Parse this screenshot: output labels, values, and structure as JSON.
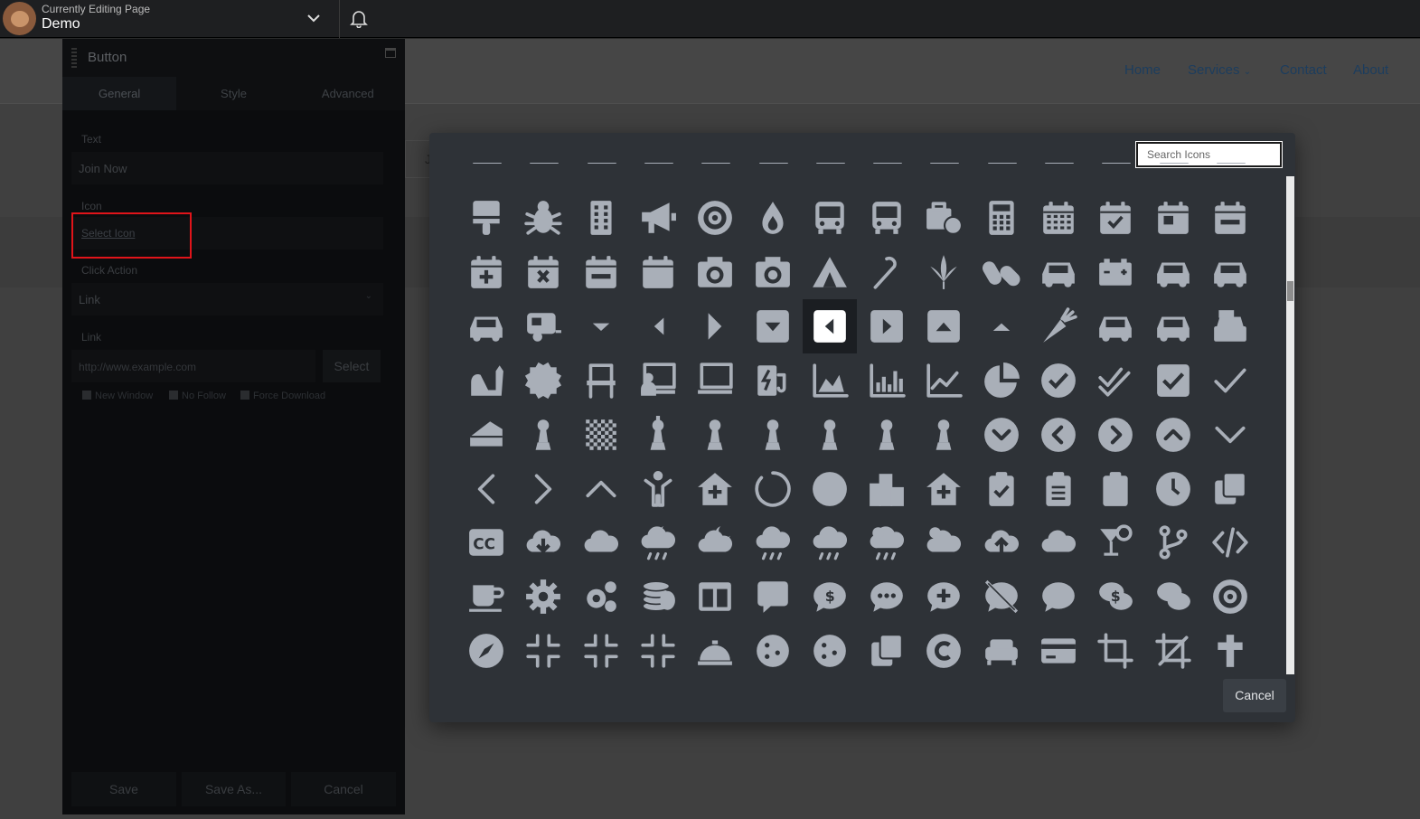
{
  "topbar": {
    "subtitle": "Currently Editing Page",
    "page_name": "Demo"
  },
  "site_nav": {
    "items": [
      "Home",
      "Services",
      "Contact",
      "About"
    ],
    "box_letter": "J"
  },
  "panel": {
    "title": "Button",
    "tabs": [
      "General",
      "Style",
      "Advanced"
    ],
    "active_tab": "General",
    "fields": {
      "text_label": "Text",
      "text_value": "Join Now",
      "icon_label": "Icon",
      "select_icon": "Select Icon",
      "click_action_label": "Click Action",
      "click_action_value": "Link",
      "link_label": "Link",
      "link_placeholder": "http://www.example.com",
      "link_select": "Select"
    },
    "checkboxes": [
      "New Window",
      "No Follow",
      "Force Download"
    ],
    "footer": {
      "save": "Save",
      "save_as": "Save As...",
      "cancel": "Cancel"
    }
  },
  "icon_picker": {
    "search_placeholder": "Search Icons",
    "cancel": "Cancel",
    "colors": {
      "icon": "#a9afb8",
      "selected_icon": "#ffffff",
      "background": "#2e3237"
    },
    "selected_index": 34,
    "icons": [
      "brush-icon",
      "bug-icon",
      "building-icon",
      "bullhorn-icon",
      "bullseye-icon",
      "burn-icon",
      "bus-icon",
      "bus-alt-icon",
      "business-time-icon",
      "calculator-icon",
      "calendar-icon",
      "calendar-check-icon",
      "calendar-day-icon",
      "calendar-minus-icon",
      "calendar-plus-icon",
      "calendar-times-icon",
      "calendar-week-icon",
      "calendar-blank-icon",
      "camera-retro-icon",
      "camera-icon",
      "campground-icon",
      "candy-cane-icon",
      "cannabis-icon",
      "capsules-icon",
      "car-icon",
      "car-battery-icon",
      "car-crash-icon",
      "car-side-icon",
      "car-alt-icon",
      "caravan-icon",
      "caret-down-icon",
      "caret-left-icon",
      "caret-right-icon",
      "caret-square-down-icon",
      "caret-square-left-icon",
      "caret-square-right-icon",
      "caret-square-up-icon",
      "caret-up-icon",
      "carrot-icon",
      "cart-arrow-down-icon",
      "cart-plus-icon",
      "cash-register-icon",
      "cat-icon",
      "certificate-icon",
      "chair-icon",
      "chalkboard-teacher-icon",
      "chalkboard-icon",
      "charging-station-icon",
      "chart-area-icon",
      "chart-bar-icon",
      "chart-line-icon",
      "chart-pie-icon",
      "check-circle-icon",
      "check-double-icon",
      "check-square-icon",
      "check-icon",
      "cheese-icon",
      "chess-bishop-icon",
      "chess-board-icon",
      "chess-king-icon",
      "chess-knight-icon",
      "chess-pawn-icon",
      "chess-queen-icon",
      "chess-rook-icon",
      "chess-icon",
      "chevron-circle-down-icon",
      "chevron-circle-left-icon",
      "chevron-circle-right-icon",
      "chevron-circle-up-icon",
      "chevron-down-icon",
      "chevron-left-icon",
      "chevron-right-icon",
      "chevron-up-icon",
      "child-icon",
      "church-icon",
      "circle-notch-icon",
      "circle-icon",
      "city-icon",
      "clinic-medical-icon",
      "clipboard-check-icon",
      "clipboard-list-icon",
      "clipboard-icon",
      "clock-icon",
      "clone-icon",
      "closed-captioning-icon",
      "cloud-download-icon",
      "cloud-meatball-icon",
      "cloud-moon-rain-icon",
      "cloud-moon-icon",
      "cloud-rain-icon",
      "cloud-showers-heavy-icon",
      "cloud-sun-rain-icon",
      "cloud-sun-icon",
      "cloud-upload-icon",
      "cloud-icon",
      "cocktail-icon",
      "code-branch-icon",
      "code-icon",
      "coffee-icon",
      "cog-icon",
      "cogs-icon",
      "coins-icon",
      "columns-icon",
      "comment-alt-icon",
      "comment-dollar-icon",
      "comment-dots-icon",
      "comment-medical-icon",
      "comment-slash-icon",
      "comment-icon",
      "comments-dollar-icon",
      "comments-icon",
      "compact-disc-icon",
      "compass-icon",
      "compress-alt-icon",
      "compress-arrows-icon",
      "compress-icon",
      "concierge-bell-icon",
      "cookie-bite-icon",
      "cookie-icon",
      "copy-icon",
      "copyright-icon",
      "couch-icon",
      "credit-card-icon",
      "crop-alt-icon",
      "crop-icon",
      "cross-icon"
    ]
  }
}
